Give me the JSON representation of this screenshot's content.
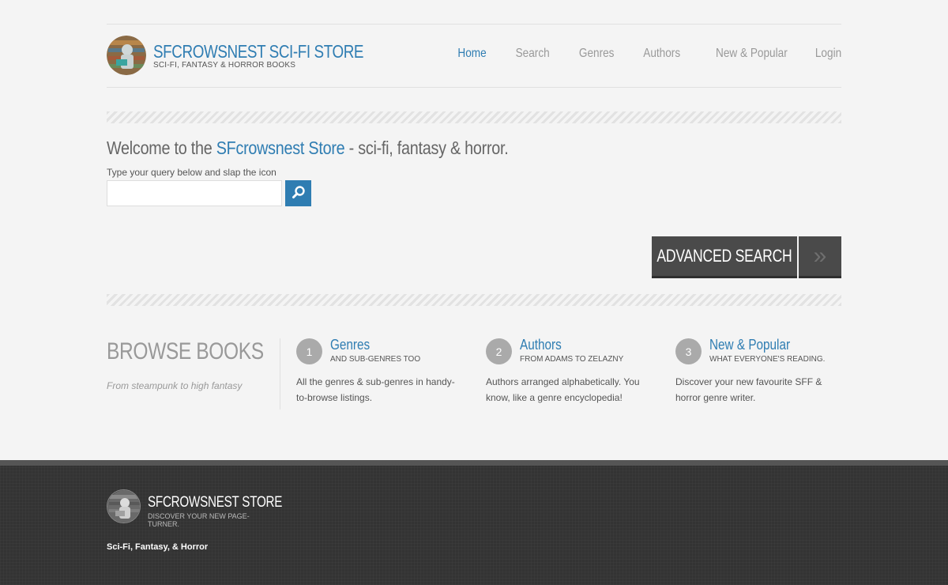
{
  "header": {
    "brand_title": "SFCROWSNEST SCI-FI STORE",
    "brand_subtitle": "SCI-FI, FANTASY & HORROR BOOKS",
    "nav": [
      {
        "label": "Home",
        "active": true
      },
      {
        "label": "Search",
        "active": false
      },
      {
        "label": "Genres",
        "active": false
      },
      {
        "label": "Authors",
        "active": false
      },
      {
        "label": "New & Popular",
        "active": false
      },
      {
        "label": "Login",
        "active": false
      }
    ]
  },
  "hero": {
    "welcome_prefix": "Welcome to the ",
    "welcome_highlight": "SFcrowsnest Store",
    "welcome_suffix": " - sci-fi, fantasy & horror.",
    "hint": "Type your query below and slap the icon",
    "search_value": "",
    "search_icon": "search-icon",
    "advanced_label": "ADVANCED SEARCH",
    "advanced_arrow": "»"
  },
  "browse": {
    "title": "BROWSE BOOKS",
    "subtitle": "From steampunk to high fantasy",
    "features": [
      {
        "num": "1",
        "title": "Genres",
        "sub": "AND SUB-GENRES TOO",
        "desc": "All the genres & sub-genres in handy-to-browse listings."
      },
      {
        "num": "2",
        "title": "Authors",
        "sub": "FROM ADAMS TO ZELAZNY",
        "desc": "Authors arranged alphabetically. You know, like a genre encyclopedia!"
      },
      {
        "num": "3",
        "title": "New & Popular",
        "sub": "WHAT EVERYONE'S READING.",
        "desc": "Discover your new favourite SFF & horror genre writer."
      }
    ]
  },
  "footer": {
    "title": "SFCROWSNEST STORE",
    "subtitle": "DISCOVER YOUR NEW PAGE-TURNER.",
    "tagline": "Sci-Fi, Fantasy, & Horror"
  },
  "colors": {
    "accent": "#2f7db2",
    "footer_bg": "#333333",
    "button_dark": "#4a4a4a"
  }
}
